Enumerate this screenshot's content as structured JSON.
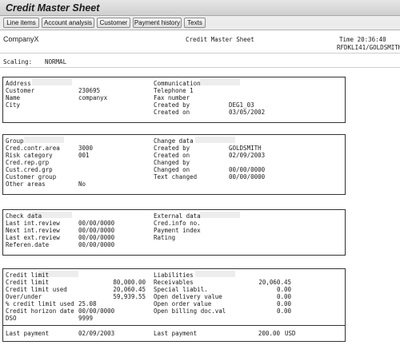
{
  "window": {
    "title": "Credit Master Sheet"
  },
  "toolbar": {
    "buttons": [
      "Line items",
      "Account analysis",
      "Customer",
      "Payment history",
      "Texts"
    ]
  },
  "header": {
    "company": "CompanyX",
    "report_title": "Credit Master Sheet",
    "time_label": "Time 20:36:40",
    "user_info": "RFDKLI41/GOLDSMITH",
    "scaling_label": "Scaling:",
    "scaling_value": "NORMAL"
  },
  "address": {
    "title": "Address",
    "customer_label": "Customer",
    "customer_value": "230695",
    "name_label": "Name",
    "name_value": "companyx",
    "city_label": "City"
  },
  "communication": {
    "title": "Communication",
    "telephone_label": "Telephone 1",
    "fax_label": "Fax number",
    "created_by_label": "Created by",
    "created_by_value": "DEG1_03",
    "created_on_label": "Created on",
    "created_on_value": "03/05/2002"
  },
  "group": {
    "title": "Group",
    "cred_contr_area_label": "Cred.contr.area",
    "cred_contr_area_value": "3000",
    "risk_category_label": "Risk category",
    "risk_category_value": "001",
    "cred_rep_grp_label": "Cred.rep.grp",
    "cust_cred_grp_label": "Cust.cred.grp",
    "customer_group_label": "Customer group",
    "other_areas_label": "Other areas",
    "other_areas_value": "No"
  },
  "change_data": {
    "title": "Change data",
    "created_by_label": "Created by",
    "created_by_value": "GOLDSMITH",
    "created_on_label": "Created on",
    "created_on_value": "02/09/2003",
    "changed_by_label": "Changed by",
    "changed_on_label": "Changed on",
    "changed_on_value": "00/00/0000",
    "text_changed_label": "Text changed",
    "text_changed_value": "00/00/0000"
  },
  "check_data": {
    "title": "Check data",
    "last_int_review_label": "Last int.review",
    "last_int_review_value": "00/00/0000",
    "next_int_review_label": "Next int.review",
    "next_int_review_value": "00/00/0000",
    "last_ext_review_label": "Last ext.review",
    "last_ext_review_value": "00/00/0000",
    "referen_date_label": "Referen.date",
    "referen_date_value": "00/00/0000"
  },
  "external_data": {
    "title": "External data",
    "cred_info_label": "Cred.info no.",
    "payment_index_label": "Payment index",
    "rating_label": "Rating"
  },
  "credit_limit": {
    "title": "Credit limit",
    "credit_limit_label": "Credit limit",
    "credit_limit_value": "80,000.00",
    "credit_limit_used_label": "Credit limit used",
    "credit_limit_used_value": "20,060.45",
    "over_under_label": "Over/under",
    "over_under_value": "59,939.55",
    "pct_used_label": "% credit limit used",
    "pct_used_value": "25.08",
    "horizon_label": "Credit horizon date",
    "horizon_value": "00/00/0000",
    "dso_label": "DSO",
    "dso_value": "9999",
    "last_payment_label": "Last payment",
    "last_payment_value": "02/09/2003"
  },
  "liabilities": {
    "title": "Liabilities",
    "receivables_label": "Receivables",
    "receivables_value": "20,060.45",
    "special_liabil_label": "Special liabil.",
    "special_liabil_value": "0.00",
    "open_delivery_label": "Open delivery value",
    "open_delivery_value": "0.00",
    "open_order_label": "Open order value",
    "open_order_value": "0.00",
    "open_billing_label": "Open billing doc.val",
    "open_billing_value": "0.00",
    "last_payment_label": "Last payment",
    "last_payment_amount": "200.00",
    "last_payment_currency": "USD"
  }
}
